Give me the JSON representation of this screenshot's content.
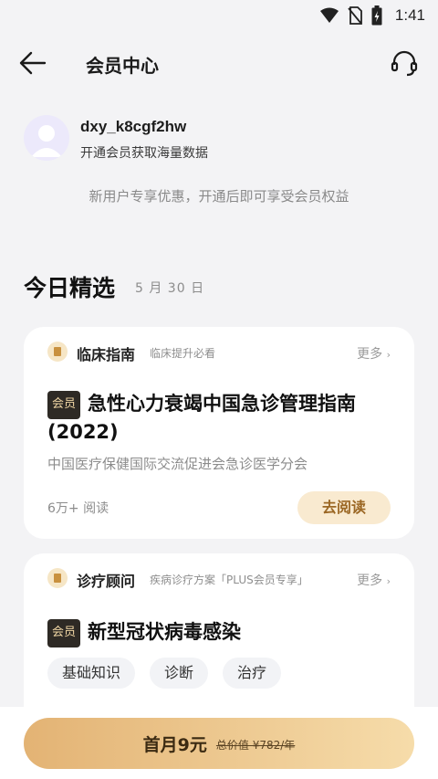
{
  "status_bar": {
    "time": "1:41",
    "icons": [
      "wifi-icon",
      "no-sim-icon",
      "battery-icon"
    ]
  },
  "header": {
    "title": "会员中心",
    "icons": [
      "back-arrow-icon",
      "headset-icon"
    ]
  },
  "user": {
    "name": "dxy_k8cgf2hw",
    "subtitle": "开通会员获取海量数据"
  },
  "promo_text": "新用户专享优惠，开通后即可享受会员权益",
  "today": {
    "title": "今日精选",
    "date": "5 月 30 日"
  },
  "cards": [
    {
      "category": "临床指南",
      "category_desc": "临床提升必看",
      "more": "更多",
      "badge": "会员",
      "title": "急性心力衰竭中国急诊管理指南(2022)",
      "source": "中国医疗保健国际交流促进会急诊医学分会",
      "reads": "6万+ 阅读",
      "action": "去阅读"
    },
    {
      "category": "诊疗顾问",
      "category_desc": "疾病诊疗方案「PLUS会员专享」",
      "more": "更多",
      "badge": "会员",
      "title": "新型冠状病毒感染",
      "tags": [
        "基础知识",
        "诊断",
        "治疗"
      ]
    }
  ],
  "purchase": {
    "price_label": "首月9元",
    "original_price": "总价值 ¥782/年"
  },
  "colors": {
    "accent": "#e3b374",
    "badge_bg": "#2e2a25",
    "badge_text": "#f0d6a4",
    "read_btn_bg": "#f9ead0"
  }
}
